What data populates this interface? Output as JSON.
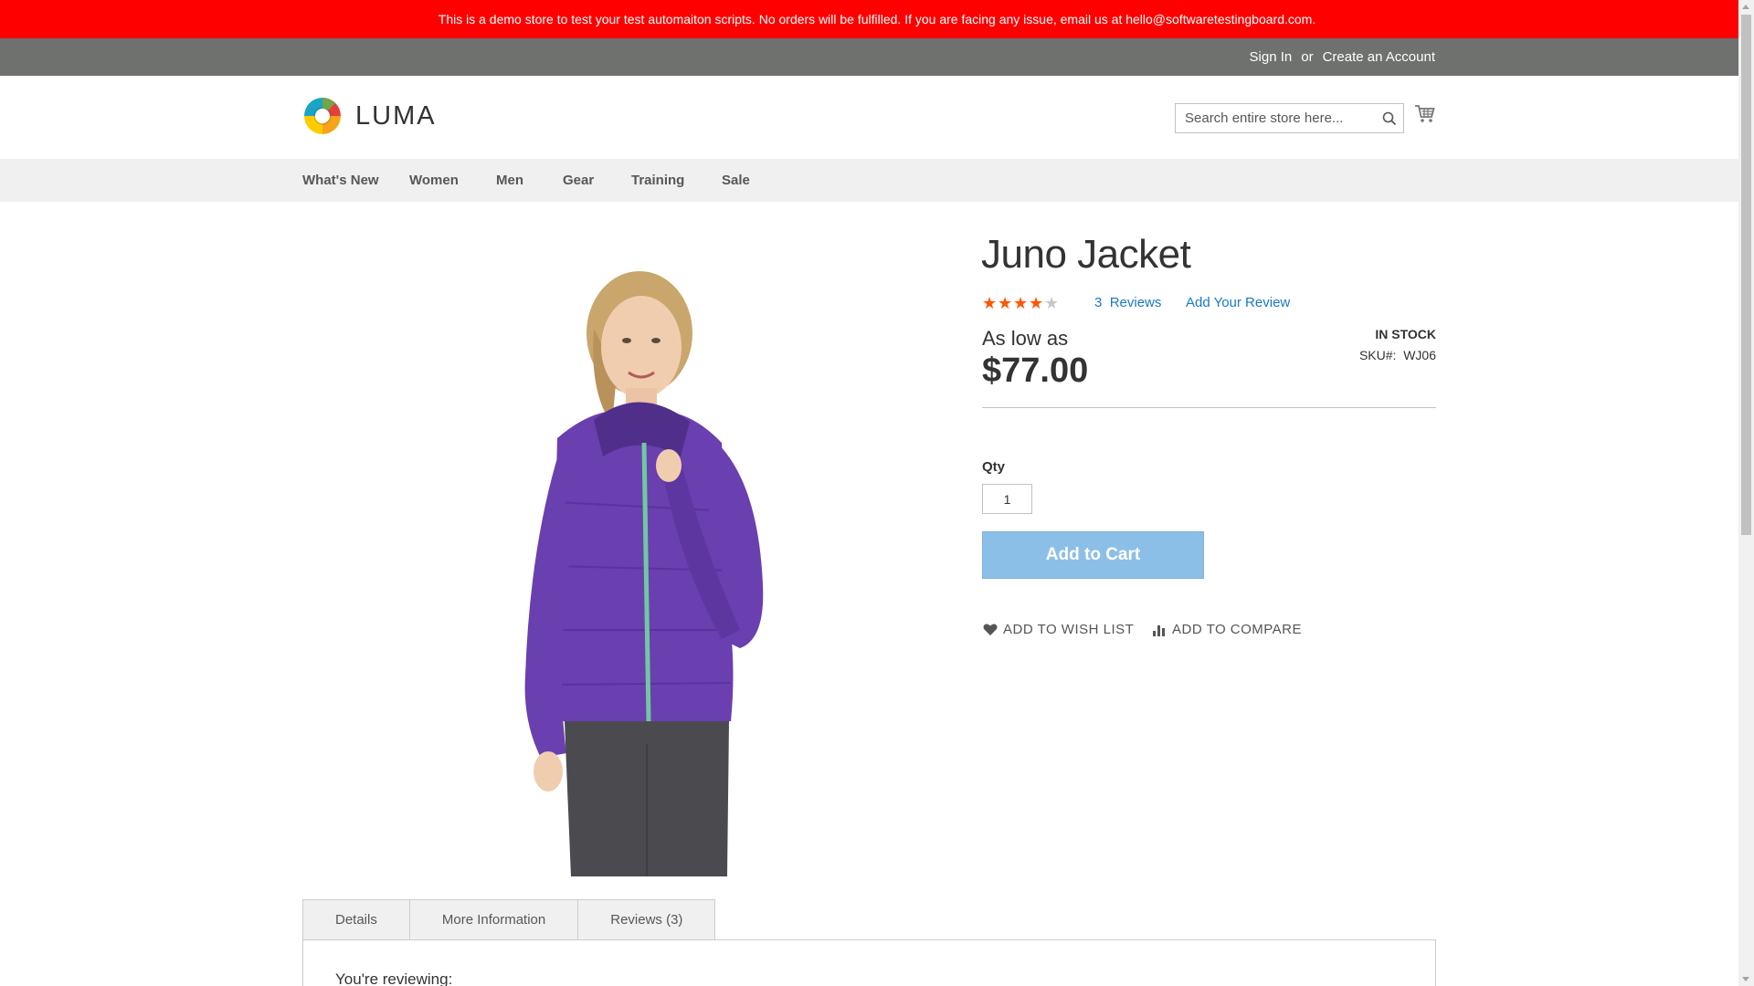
{
  "banner": {
    "text": "This is a demo store to test your test automaiton scripts. No orders will be fulfilled. If you are facing any issue, email us at hello@softwaretestingboard.com."
  },
  "header_links": {
    "sign_in": "Sign In",
    "or": "or",
    "create_account": "Create an Account"
  },
  "logo": {
    "text": "LUMA"
  },
  "search": {
    "placeholder": "Search entire store here...",
    "icon": "search-icon"
  },
  "cart": {
    "icon": "cart-icon"
  },
  "nav": {
    "items": [
      "What's New",
      "Women",
      "Men",
      "Gear",
      "Training",
      "Sale"
    ]
  },
  "product": {
    "title": "Juno Jacket",
    "rating_percent": 80,
    "reviews_count": "3",
    "reviews_label": "Reviews",
    "add_review": "Add Your Review",
    "as_low_as": "As low as",
    "price": "$77.00",
    "stock": "IN STOCK",
    "sku_label": "SKU#:",
    "sku": "WJ06",
    "qty_label": "Qty",
    "qty_value": "1",
    "add_to_cart": "Add to Cart",
    "add_to_wishlist": "Add to Wish List",
    "add_to_compare": "Add to Compare",
    "image_alt": "Juno Jacket product image - woman in purple quilted jacket"
  },
  "tabs": {
    "items": [
      "Details",
      "More Information",
      "Reviews (3)"
    ],
    "active_index": 2,
    "content_text": "You're reviewing:"
  },
  "colors": {
    "banner": "#ff0000",
    "header_bar": "#6e716e",
    "nav_bg": "#f0f0f0",
    "link": "#1979c3",
    "star": "#ff5501",
    "star_empty": "#c7c7c7",
    "add_to_cart": "#8cbfe7",
    "jacket": "#6a3fb0"
  }
}
